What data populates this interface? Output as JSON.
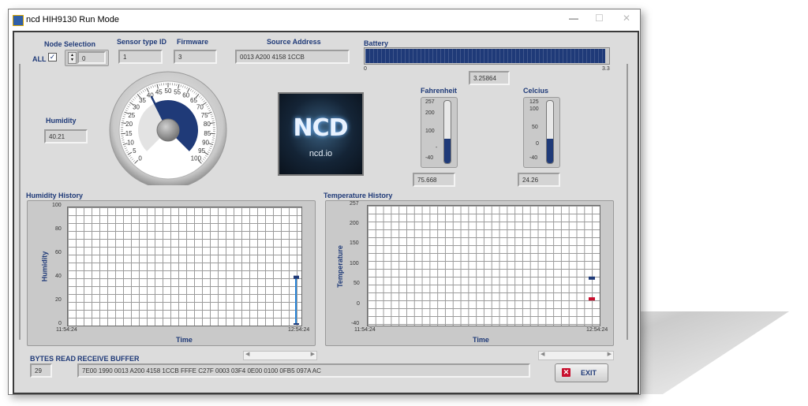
{
  "window": {
    "title": "ncd HIH9130 Run Mode"
  },
  "header": {
    "node_selection_label": "Node Selection",
    "all_label": "ALL",
    "all_checked": true,
    "node_value": "0",
    "sensor_type_label": "Sensor type ID",
    "sensor_type_value": "1",
    "firmware_label": "Firmware",
    "firmware_value": "3",
    "source_address_label": "Source Address",
    "source_address_value": "0013 A200 4158 1CCB",
    "battery_label": "Battery",
    "battery_min": "0",
    "battery_max": "3.3",
    "battery_value": "3.25864",
    "battery_fraction": 0.987
  },
  "humidity": {
    "label": "Humidity",
    "value": "40.21",
    "gauge_value": 40.21,
    "gauge_ticks": [
      "0",
      "5",
      "10",
      "15",
      "20",
      "25",
      "30",
      "35",
      "40",
      "45",
      "50",
      "55",
      "60",
      "65",
      "70",
      "75",
      "80",
      "85",
      "90",
      "95",
      "100"
    ]
  },
  "logo": {
    "brand": "NCD",
    "site": "ncd.io"
  },
  "fahrenheit": {
    "label": "Fahrenheit",
    "value": "75.668",
    "ticks": [
      "257",
      "200",
      "100",
      "-",
      "-40"
    ],
    "level": 75.668,
    "min": -40,
    "max": 257
  },
  "celcius": {
    "label": "Celcius",
    "value": "24.26",
    "ticks": [
      "125",
      "100",
      "50",
      "0",
      "-40"
    ],
    "level": 24.26,
    "min": -40,
    "max": 125
  },
  "humidity_history": {
    "title": "Humidity History",
    "ylabel": "Humidity",
    "xlabel": "Time",
    "yticks": [
      "100",
      "80",
      "60",
      "40",
      "20",
      "0"
    ],
    "x_start": "11:54:24",
    "x_end": "12:54:24"
  },
  "temperature_history": {
    "title": "Temperature History",
    "ylabel": "Temperature",
    "xlabel": "Time",
    "yticks": [
      "257",
      "200",
      "150",
      "100",
      "50",
      "0",
      "-40"
    ],
    "x_start": "11:54:24",
    "x_end": "12:54:24"
  },
  "chart_data": [
    {
      "type": "line",
      "title": "Humidity History",
      "xlabel": "Time",
      "ylabel": "Humidity",
      "ylim": [
        0,
        100
      ],
      "x": [
        "12:54:24",
        "12:54:24"
      ],
      "series": [
        {
          "values": [
            0,
            40.21
          ]
        }
      ]
    },
    {
      "type": "line",
      "title": "Temperature History",
      "xlabel": "Time",
      "ylabel": "Temperature",
      "ylim": [
        -40,
        257
      ],
      "x": [
        "12:54:24"
      ],
      "series": [
        {
          "values": [
            75.668
          ],
          "color": "#1f3a78"
        },
        {
          "values": [
            24.26
          ],
          "color": "#c8102e"
        }
      ]
    }
  ],
  "footer": {
    "bytes_read_label": "BYTES READ",
    "bytes_read_value": "29",
    "receive_buffer_label": "RECEIVE BUFFER",
    "receive_buffer_value": "7E00 1990 0013 A200 4158 1CCB FFFE C27F 0003 03F4 0E00 0100 0FB5 097A AC",
    "exit_label": "EXIT"
  },
  "colors": {
    "label_blue": "#1f3a78",
    "gauge_blue": "#1f3a78",
    "battery_blue": "#1f3a78",
    "temp_red": "#c8102e"
  }
}
